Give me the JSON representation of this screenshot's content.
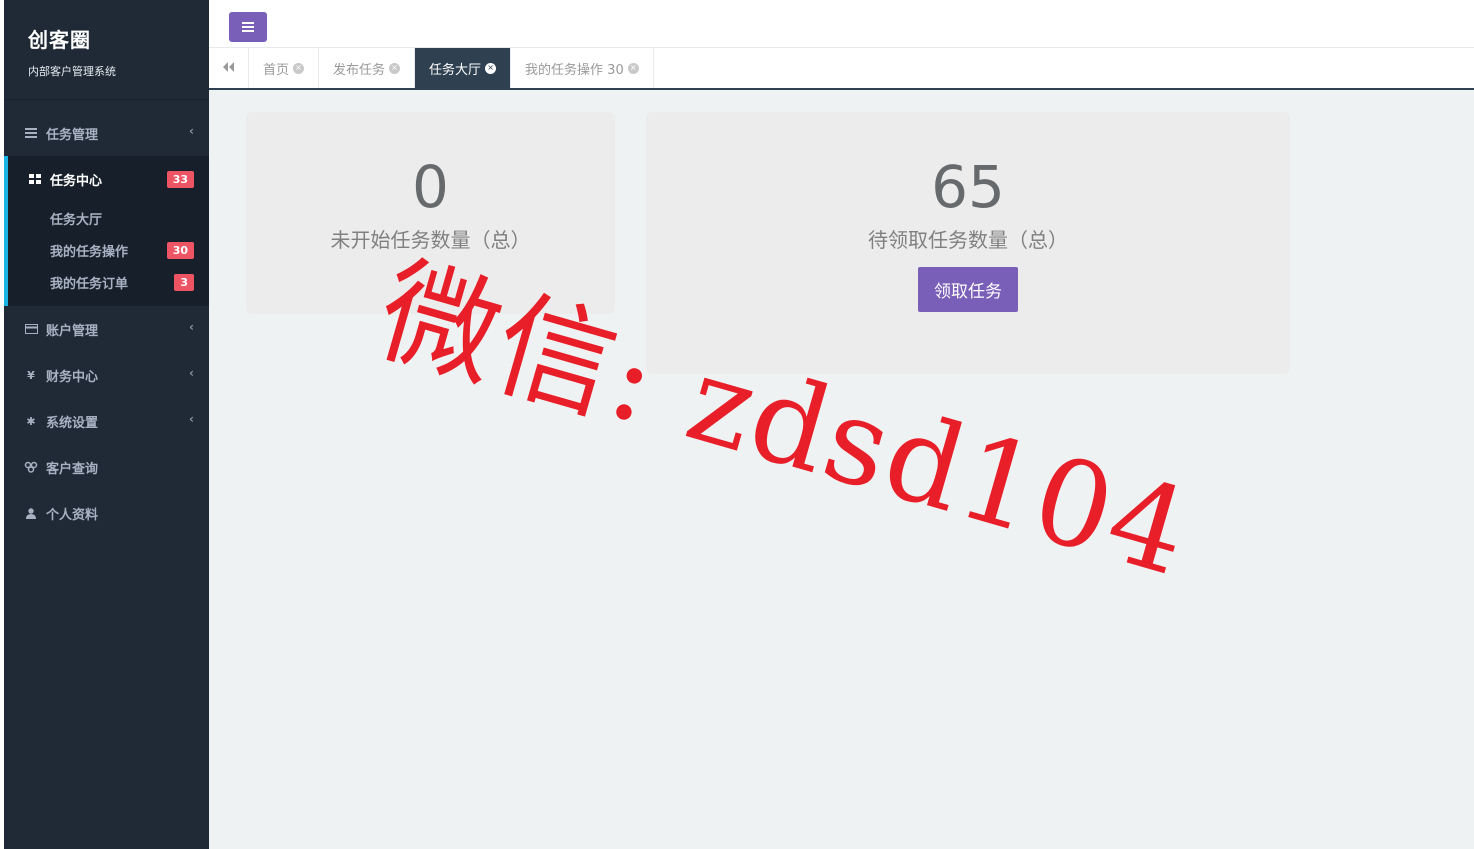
{
  "brand": {
    "title": "创客圈",
    "subtitle": "内部客户管理系统"
  },
  "sidebar": {
    "items": [
      {
        "label": "任务管理",
        "icon": "list-icon"
      },
      {
        "label": "任务中心",
        "icon": "grid-icon",
        "badge": "33",
        "children": [
          {
            "label": "任务大厅"
          },
          {
            "label": "我的任务操作",
            "badge": "30"
          },
          {
            "label": "我的任务订单",
            "badge": "3"
          }
        ]
      },
      {
        "label": "账户管理",
        "icon": "credit-card-icon"
      },
      {
        "label": "财务中心",
        "icon": "yen-icon"
      },
      {
        "label": "系统设置",
        "icon": "gear-icon"
      },
      {
        "label": "客户查询",
        "icon": "users-icon"
      },
      {
        "label": "个人资料",
        "icon": "user-icon"
      }
    ]
  },
  "tabs": [
    {
      "label": "首页"
    },
    {
      "label": "发布任务"
    },
    {
      "label": "任务大厅",
      "active": true
    },
    {
      "label": "我的任务操作 30"
    }
  ],
  "stats": {
    "not_started": {
      "value": "0",
      "label": "未开始任务数量（总）"
    },
    "to_claim": {
      "value": "65",
      "label": "待领取任务数量（总）",
      "button": "领取任务"
    }
  },
  "watermark": "微信: zdsd104",
  "colors": {
    "sidebar_bg": "#1f2a36",
    "accent": "#7a5fb8",
    "badge": "#ed5565",
    "active_border": "#1ab3e6",
    "watermark": "#e8141e"
  }
}
